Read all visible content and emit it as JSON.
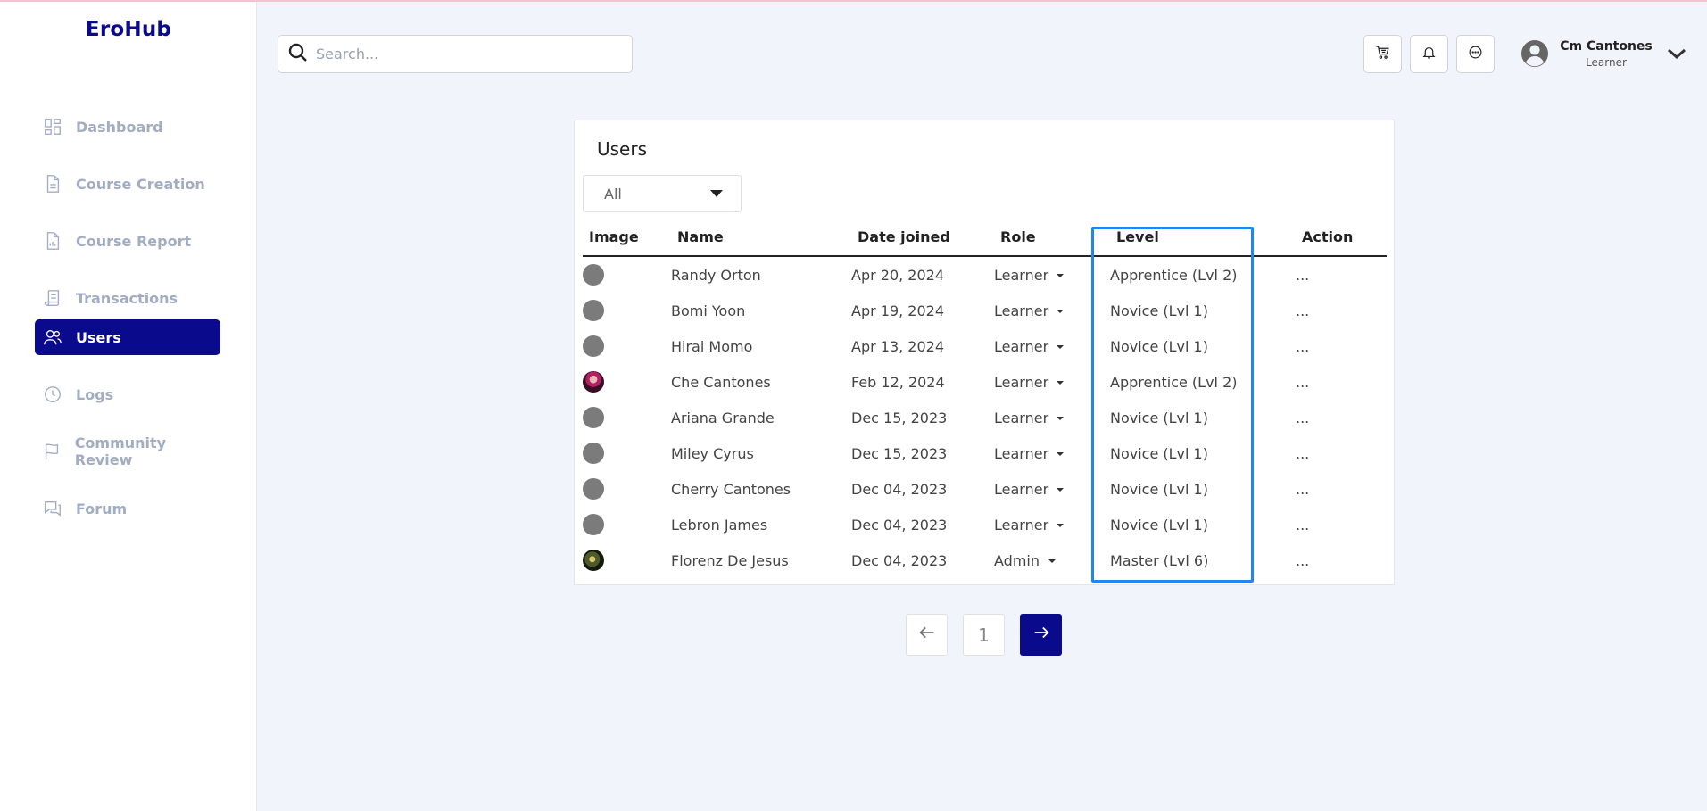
{
  "brand": {
    "name": "EroHub"
  },
  "sidebar": {
    "items": [
      {
        "label": "Dashboard",
        "icon": "dashboard-icon"
      },
      {
        "label": "Course Creation",
        "icon": "document-icon"
      },
      {
        "label": "Course Report",
        "icon": "report-icon"
      },
      {
        "label": "Transactions",
        "icon": "receipt-icon"
      },
      {
        "label": "Users",
        "icon": "users-icon",
        "active": true
      },
      {
        "label": "Logs",
        "icon": "clock-icon"
      },
      {
        "label": "Community Review",
        "icon": "flag-icon"
      },
      {
        "label": "Forum",
        "icon": "chat-icon"
      }
    ]
  },
  "header": {
    "search_placeholder": "Search...",
    "icons": [
      "cart-icon",
      "bell-icon",
      "message-icon"
    ],
    "user": {
      "name": "Cm Cantones",
      "role": "Learner"
    }
  },
  "users_table": {
    "title": "Users",
    "filter_value": "All",
    "columns": [
      "Image",
      "Name",
      "Date joined",
      "Role",
      "Level",
      "Action"
    ],
    "rows": [
      {
        "name": "Randy Orton",
        "date": "Apr 20, 2024",
        "role": "Learner",
        "level": "Apprentice (Lvl 2)",
        "action": "..."
      },
      {
        "name": "Bomi Yoon",
        "date": "Apr 19, 2024",
        "role": "Learner",
        "level": "Novice (Lvl 1)",
        "action": "..."
      },
      {
        "name": "Hirai Momo",
        "date": "Apr 13, 2024",
        "role": "Learner",
        "level": "Novice (Lvl 1)",
        "action": "..."
      },
      {
        "name": "Che Cantones",
        "date": "Feb 12, 2024",
        "role": "Learner",
        "level": "Apprentice (Lvl 2)",
        "action": "..."
      },
      {
        "name": "Ariana Grande",
        "date": "Dec 15, 2023",
        "role": "Learner",
        "level": "Novice (Lvl 1)",
        "action": "..."
      },
      {
        "name": "Miley Cyrus",
        "date": "Dec 15, 2023",
        "role": "Learner",
        "level": "Novice (Lvl 1)",
        "action": "..."
      },
      {
        "name": "Cherry Cantones",
        "date": "Dec 04, 2023",
        "role": "Learner",
        "level": "Novice (Lvl 1)",
        "action": "..."
      },
      {
        "name": "Lebron James",
        "date": "Dec 04, 2023",
        "role": "Learner",
        "level": "Novice (Lvl 1)",
        "action": "..."
      },
      {
        "name": "Florenz De Jesus",
        "date": "Dec 04, 2023",
        "role": "Admin",
        "level": "Master (Lvl 6)",
        "action": "..."
      }
    ]
  },
  "pagination": {
    "current_page": "1"
  },
  "colors": {
    "brand": "#0a0a8c",
    "highlight": "#1e88f0",
    "sidebar_text": "#a2adc4"
  }
}
